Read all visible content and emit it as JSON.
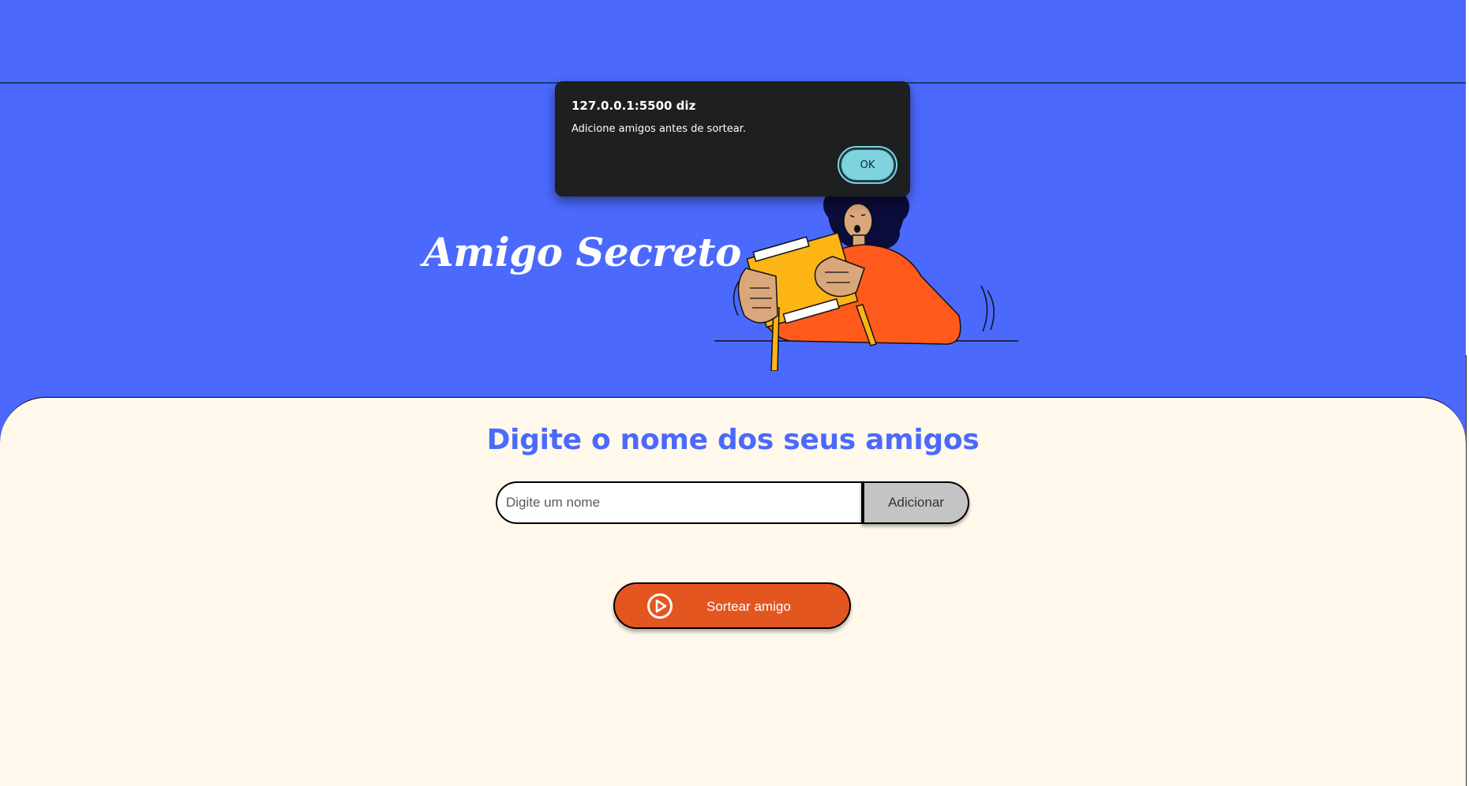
{
  "header": {
    "title": "Amigo Secreto"
  },
  "main": {
    "heading": "Digite o nome dos seus amigos",
    "name_input": {
      "value": "",
      "placeholder": "Digite um nome"
    },
    "add_button_label": "Adicionar",
    "draw_button_label": "Sortear amigo"
  },
  "dialog": {
    "origin": "127.0.0.1:5500 diz",
    "message": "Adicione amigos antes de sortear.",
    "ok_label": "OK"
  },
  "colors": {
    "header_blue": "#4b69fd",
    "main_background": "#fff8eb",
    "accent_orange": "#e4561f",
    "add_button_gray": "#c4c4c4",
    "dialog_background": "#1d1f20",
    "dialog_ok": "#7fd3df"
  },
  "icons": {
    "draw_button_icon": "play-circle-icon",
    "illustration": "person-opening-gift-illustration"
  }
}
